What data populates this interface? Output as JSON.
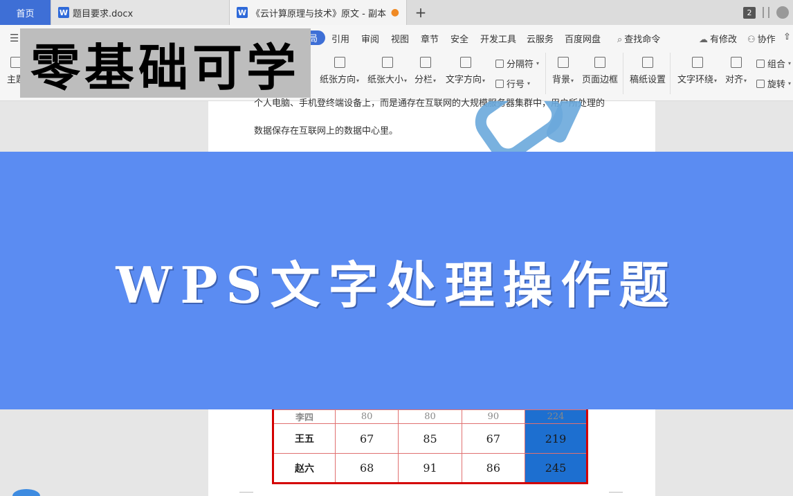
{
  "tabs": {
    "home": "首页",
    "doc1": "题目要求.docx",
    "doc2": "《云计算原理与技术》原文 - 副本",
    "add": "+",
    "window_count": "2"
  },
  "menu": {
    "active_partial": "局",
    "items": [
      "引用",
      "审阅",
      "视图",
      "章节",
      "安全",
      "开发工具",
      "云服务",
      "百度网盘"
    ],
    "search": "查找命令",
    "has_changes": "有修改",
    "collab": "协作"
  },
  "ribbon": {
    "theme_partial": "主题",
    "buttons": [
      {
        "label": "纸张方向",
        "caret": "▾"
      },
      {
        "label": "纸张大小",
        "caret": "▾"
      },
      {
        "label": "分栏",
        "caret": "▾"
      },
      {
        "label": "文字方向",
        "caret": "▾"
      },
      {
        "label": "背景",
        "caret": "▾"
      },
      {
        "label": "页面边框",
        "caret": ""
      },
      {
        "label": "稿纸设置",
        "caret": ""
      },
      {
        "label": "文字环绕",
        "caret": "▾"
      },
      {
        "label": "对齐",
        "caret": "▾"
      }
    ],
    "small": {
      "separator": "分隔符",
      "line_number": "行号",
      "group": "组合",
      "rotate": "旋转"
    }
  },
  "overlay": {
    "title": "零基础可学",
    "banner": "WPS文字处理操作题"
  },
  "document": {
    "line1": "个人电脑、手机登终端设备上，而是通存在互联网的大规模服务器集群中，用户所处理的",
    "line2": "数据保存在互联网上的数据中心里。"
  },
  "table": {
    "partial_row": [
      "李四",
      "80",
      "80",
      "90",
      "224"
    ],
    "rows": [
      [
        "王五",
        "67",
        "85",
        "67",
        "219"
      ],
      [
        "赵六",
        "68",
        "91",
        "86",
        "245"
      ]
    ]
  }
}
